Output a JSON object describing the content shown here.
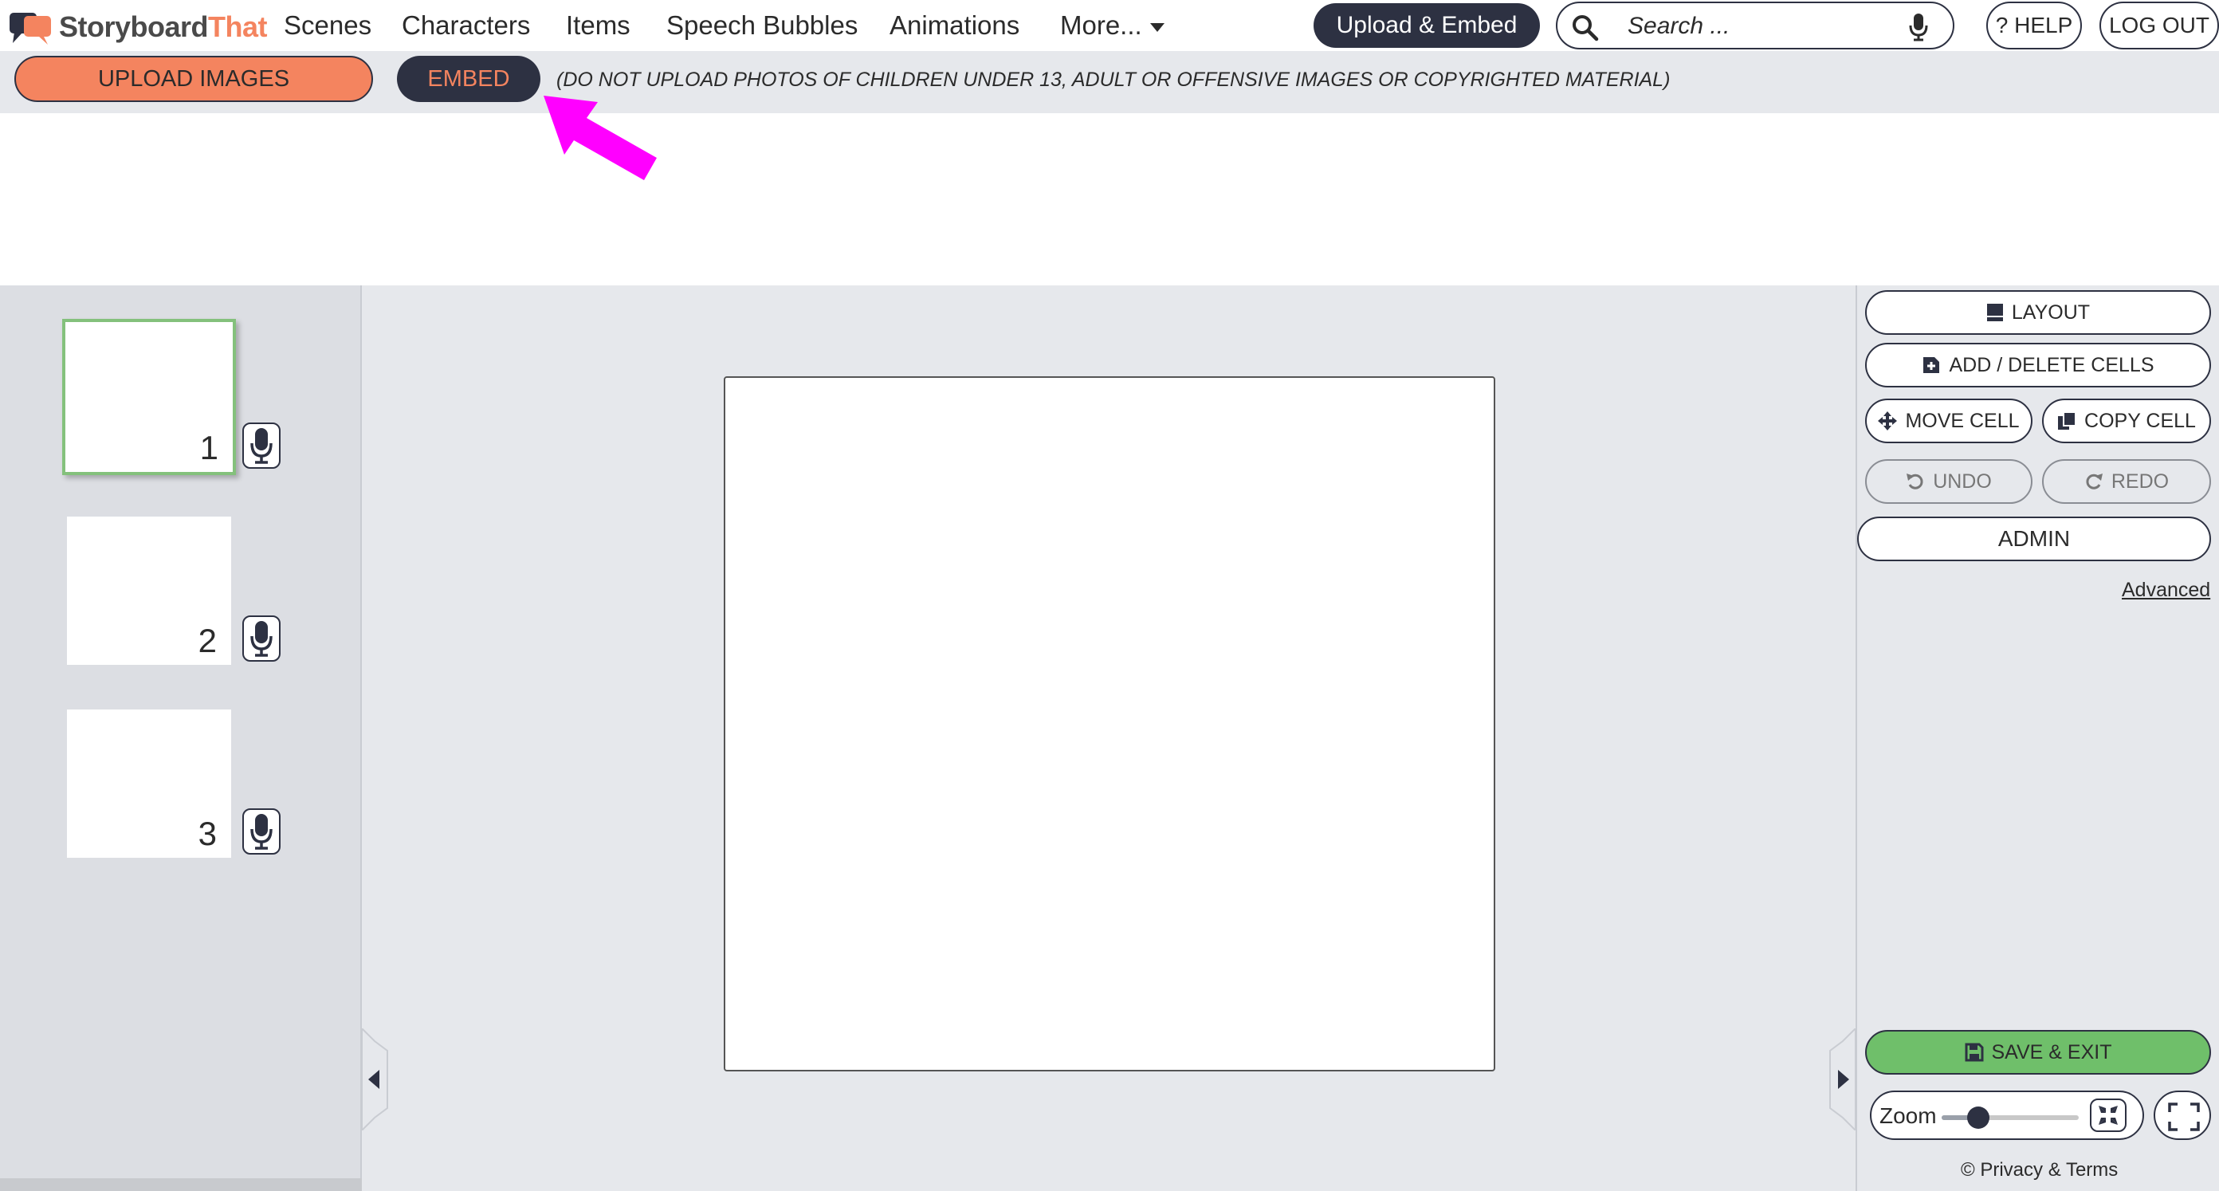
{
  "brand": {
    "part1": "Storyboard",
    "part2": "That"
  },
  "nav": {
    "scenes": "Scenes",
    "characters": "Characters",
    "items": "Items",
    "speech_bubbles": "Speech Bubbles",
    "animations": "Animations",
    "more": "More..."
  },
  "header": {
    "upload_embed": "Upload & Embed",
    "search_placeholder": "Search ...",
    "help": "? HELP",
    "logout": "LOG OUT"
  },
  "upload_bar": {
    "upload_images": "UPLOAD IMAGES",
    "embed": "EMBED",
    "warning": "(DO NOT UPLOAD PHOTOS OF CHILDREN UNDER 13, ADULT OR OFFENSIVE IMAGES OR COPYRIGHTED MATERIAL)"
  },
  "cells": [
    {
      "number": "1",
      "selected": true
    },
    {
      "number": "2",
      "selected": false
    },
    {
      "number": "3",
      "selected": false
    }
  ],
  "tools": {
    "layout": "LAYOUT",
    "add_delete_cells": "ADD / DELETE CELLS",
    "move_cell": "MOVE CELL",
    "copy_cell": "COPY CELL",
    "undo": "UNDO",
    "redo": "REDO",
    "admin": "ADMIN",
    "advanced": "Advanced",
    "save_exit": "SAVE & EXIT",
    "zoom_label": "Zoom",
    "zoom_level": 0.27,
    "privacy_terms": "© Privacy & Terms"
  },
  "colors": {
    "accent_orange": "#f4845f",
    "navy": "#2d3142",
    "save_green": "#6fbf6a",
    "selected_cell_border": "#84c17c",
    "annotation_arrow": "#ff00ff"
  }
}
